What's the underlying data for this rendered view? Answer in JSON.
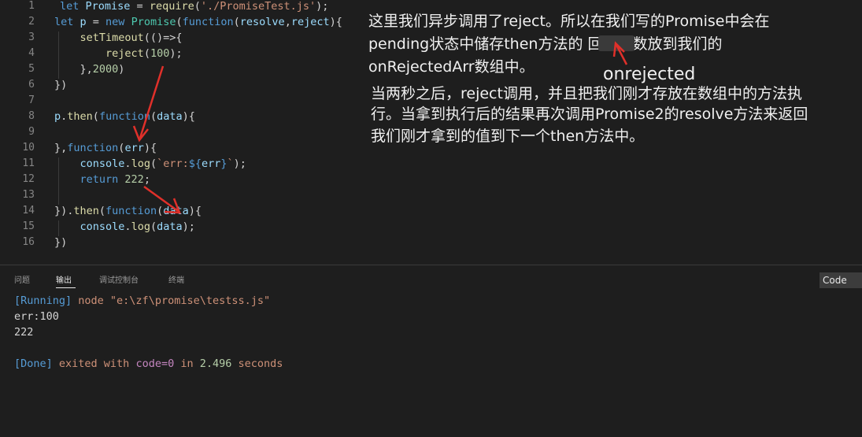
{
  "editor": {
    "line_numbers": [
      "1",
      "2",
      "3",
      "4",
      "5",
      "6",
      "7",
      "8",
      "9",
      "10",
      "11",
      "12",
      "13",
      "14",
      "15",
      "16"
    ],
    "lines": [
      [
        [
          "kw",
          "let "
        ],
        [
          "vr",
          "Promise"
        ],
        [
          "pl",
          " = "
        ],
        [
          "fn",
          "require"
        ],
        [
          "pl",
          "("
        ],
        [
          "st",
          "'./PromiseTest.js'"
        ],
        [
          "pl",
          ");"
        ]
      ],
      [
        [
          "kw",
          "let "
        ],
        [
          "vr",
          "p"
        ],
        [
          "pl",
          " = "
        ],
        [
          "kw",
          "new "
        ],
        [
          "ty",
          "Promise"
        ],
        [
          "pl",
          "("
        ],
        [
          "kw",
          "function"
        ],
        [
          "pl",
          "("
        ],
        [
          "vr",
          "resolve"
        ],
        [
          "pl",
          ","
        ],
        [
          "vr",
          "reject"
        ],
        [
          "pl",
          "){"
        ]
      ],
      [
        [
          "pl",
          "    "
        ],
        [
          "fn",
          "setTimeout"
        ],
        [
          "pl",
          "(()=>{"
        ]
      ],
      [
        [
          "pl",
          "        "
        ],
        [
          "fn",
          "reject"
        ],
        [
          "pl",
          "("
        ],
        [
          "nm",
          "100"
        ],
        [
          "pl",
          ");"
        ]
      ],
      [
        [
          "pl",
          "    },"
        ],
        [
          "nm",
          "2000"
        ],
        [
          "pl",
          ")"
        ]
      ],
      [
        [
          "pl",
          "})"
        ]
      ],
      [],
      [
        [
          "vr",
          "p"
        ],
        [
          "pl",
          "."
        ],
        [
          "fn",
          "then"
        ],
        [
          "pl",
          "("
        ],
        [
          "kw",
          "function"
        ],
        [
          "pl",
          "("
        ],
        [
          "vr",
          "data"
        ],
        [
          "pl",
          "){"
        ]
      ],
      [],
      [
        [
          "pl",
          "},"
        ],
        [
          "kw",
          "function"
        ],
        [
          "pl",
          "("
        ],
        [
          "vr",
          "err"
        ],
        [
          "pl",
          "){"
        ]
      ],
      [
        [
          "pl",
          "    "
        ],
        [
          "vr",
          "console"
        ],
        [
          "pl",
          "."
        ],
        [
          "fn",
          "log"
        ],
        [
          "pl",
          "("
        ],
        [
          "st",
          "`err:"
        ],
        [
          "kw",
          "${"
        ],
        [
          "vr",
          "err"
        ],
        [
          "kw",
          "}"
        ],
        [
          "st",
          "`"
        ],
        [
          "pl",
          ");"
        ]
      ],
      [
        [
          "pl",
          "    "
        ],
        [
          "kw",
          "return "
        ],
        [
          "nm",
          "222"
        ],
        [
          "pl",
          ";"
        ]
      ],
      [],
      [
        [
          "pl",
          "})."
        ],
        [
          "fn",
          "then"
        ],
        [
          "pl",
          "("
        ],
        [
          "kw",
          "function"
        ],
        [
          "pl",
          "("
        ],
        [
          "vr",
          "data"
        ],
        [
          "pl",
          "){"
        ]
      ],
      [
        [
          "pl",
          "    "
        ],
        [
          "vr",
          "console"
        ],
        [
          "pl",
          "."
        ],
        [
          "fn",
          "log"
        ],
        [
          "pl",
          "("
        ],
        [
          "vr",
          "data"
        ],
        [
          "pl",
          ");"
        ]
      ],
      [
        [
          "pl",
          "})"
        ]
      ]
    ]
  },
  "annotation": {
    "lines": [
      "这里我们异步调用了reject。所以在我们写的Promise中会在",
      "pending状态中储存then方法的        回调函数放到我们的",
      "onRejectedArr数组中。",
      "当两秒之后，reject调用，并且把我们刚才存放在数组中的方法执",
      "行。当拿到执行后的结果再次调用Promise2的resolve方法来返回",
      "我们刚才拿到的值到下一个then方法中。"
    ],
    "label": "onrejected"
  },
  "panel": {
    "tabs": [
      "问题",
      "输出",
      "调试控制台",
      "终端"
    ],
    "active_tab": "输出",
    "dropdown_value": "Code",
    "output": {
      "running_tag": "[Running]",
      "running_cmd": " node \"e:\\zf\\promise\\testss.js\"",
      "line2": "err:100",
      "line3": "222",
      "done_tag": "[Done]",
      "done_text1": " exited with ",
      "done_code": "code=0",
      "done_text2": " in ",
      "done_time": "2.496",
      "done_text3": " seconds"
    }
  },
  "colors": {
    "arrow": "#e0302a",
    "background": "#1e1e1e"
  }
}
